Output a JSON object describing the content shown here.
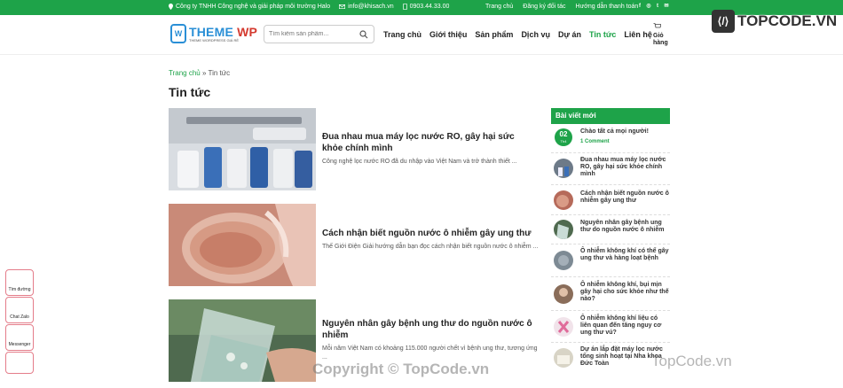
{
  "topbar": {
    "company": "Công ty TNHH Công nghệ và giải pháp môi trường Halo",
    "email": "info@khisach.vn",
    "phone": "0903.44.33.00",
    "links": [
      "Trang chủ",
      "Đăng ký đối tác",
      "Hướng dẫn thanh toán"
    ],
    "social_icons": [
      "facebook-icon",
      "instagram-icon",
      "twitter-icon",
      "email-icon"
    ]
  },
  "header": {
    "logo_main": "THEME",
    "logo_accent": "WP",
    "logo_tagline": "THEME WORDPRESS GIÁ RẺ",
    "search_placeholder": "Tìm kiếm sản phẩm...",
    "nav": [
      "Trang chủ",
      "Giới thiệu",
      "Sản phẩm",
      "Dịch vụ",
      "Dự án",
      "Tin tức",
      "Liên hệ"
    ],
    "active_nav": "Tin tức",
    "cart_label": "Giỏ hàng"
  },
  "breadcrumb": {
    "home": "Trang chủ",
    "sep": " » ",
    "current": "Tin tức"
  },
  "page_title": "Tin tức",
  "posts": [
    {
      "title": "Đua nhau mua máy lọc nước RO, gây hại sức khỏe chính mình",
      "excerpt": "Công nghệ lọc nước RO đã du nhập vào Việt Nam và trở thành thiết ..."
    },
    {
      "title": "Cách nhận biết nguồn nước ô nhiễm gây ung thư",
      "excerpt": "Thế Giới Điện Giải hướng dẫn bạn đọc cách nhận biết nguồn nước ô nhiễm ..."
    },
    {
      "title": "Nguyên nhân gây bệnh ung thư do nguồn nước ô nhiễm",
      "excerpt": "Mỗi năm Việt Nam có khoảng 115.000 người chết vì bệnh ung thư, tương ứng ..."
    }
  ],
  "sidebar": {
    "heading": "Bài viết mới",
    "first": {
      "day": "02",
      "month": "Th4",
      "title": "Chào tất cả mọi người!",
      "comments": "1 Comment"
    },
    "items": [
      "Đua nhau mua máy lọc nước RO, gây hại sức khỏe chính mình",
      "Cách nhận biết nguồn nước ô nhiễm gây ung thư",
      "Nguyên nhân gây bệnh ung thư do nguồn nước ô nhiễm",
      "Ô nhiễm không khí có thể gây ung thư và hàng loạt bệnh",
      "Ô nhiễm không khí, bụi mịn gây hại cho sức khỏe như thế nào?",
      "Ô nhiễm không khí liệu có liên quan đến tăng nguy cơ ung thư vú?",
      "Dự án lắp đặt máy lọc nước tổng sinh hoạt tại Nha khoa Đức Toàn"
    ]
  },
  "float_buttons": [
    "Tìm đường",
    "Chat Zalo",
    "Messenger",
    ""
  ],
  "watermark": {
    "brand": "TOPCODE.VN",
    "copyright": "Copyright © TopCode.vn",
    "bottom": "TopCode.vn"
  }
}
